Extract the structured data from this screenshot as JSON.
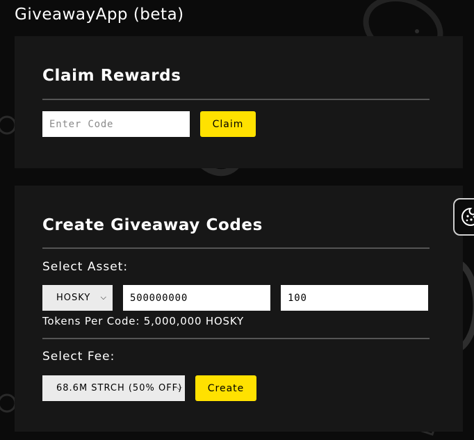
{
  "app": {
    "title": "GiveawayApp (beta)"
  },
  "claim": {
    "title": "Claim Rewards",
    "code_placeholder": "Enter Code",
    "code_value": "",
    "claim_label": "Claim"
  },
  "create": {
    "title": "Create Giveaway Codes",
    "select_asset_label": "Select Asset:",
    "asset_selected": "HOSKY",
    "amount_value": "500000000",
    "codes_value": "100",
    "tokens_per_code": "Tokens Per Code: 5,000,000 HOSKY",
    "select_fee_label": "Select Fee:",
    "fee_selected": "68.6M STRCH (50% OFF)",
    "create_label": "Create"
  },
  "icons": {
    "wallet": "cookie-wallet-icon",
    "select_chevron": "chevron-down-icon"
  },
  "colors": {
    "background": "#0b0b0b",
    "card": "#171717",
    "accent": "#ffe100",
    "divider": "#555555"
  }
}
